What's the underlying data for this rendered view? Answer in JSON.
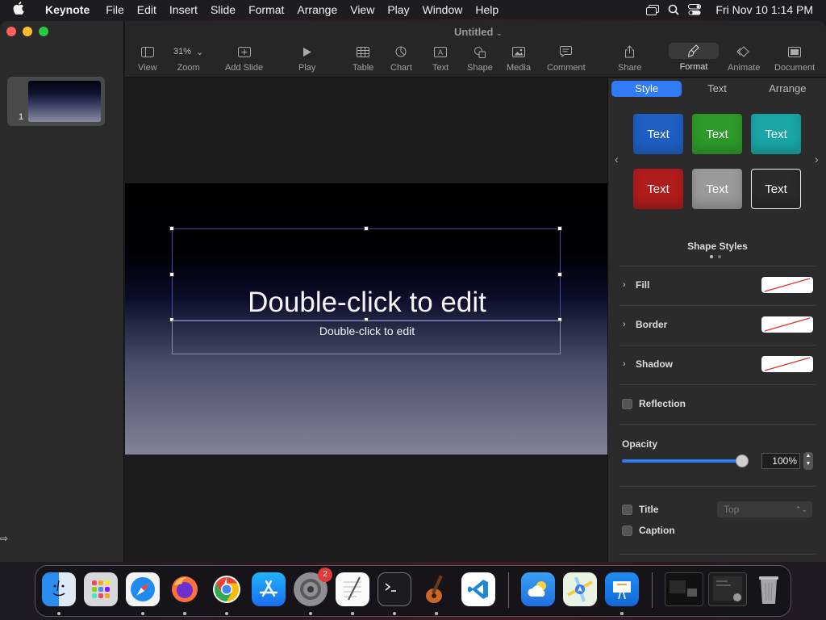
{
  "menubar": {
    "app_name": "Keynote",
    "items": [
      "File",
      "Edit",
      "Insert",
      "Slide",
      "Format",
      "Arrange",
      "View",
      "Play",
      "Window",
      "Help"
    ],
    "clock": "Fri Nov 10  1:14 PM"
  },
  "window": {
    "title": "Untitled"
  },
  "sidebar": {
    "slides": [
      {
        "number": "1"
      }
    ]
  },
  "toolbar": {
    "view": "View",
    "zoom_value": "31%",
    "zoom": "Zoom",
    "add_slide": "Add Slide",
    "play": "Play",
    "table": "Table",
    "chart": "Chart",
    "text": "Text",
    "shape": "Shape",
    "media": "Media",
    "comment": "Comment",
    "share": "Share",
    "format": "Format",
    "animate": "Animate",
    "document": "Document"
  },
  "slide": {
    "title_placeholder": "Double-click to edit",
    "subtitle_placeholder": "Double-click to edit"
  },
  "inspector": {
    "tabs": [
      "Style",
      "Text",
      "Arrange"
    ],
    "style_tiles": [
      {
        "label": "Text",
        "color": "#1f5fc4"
      },
      {
        "label": "Text",
        "color": "#2e9a2a"
      },
      {
        "label": "Text",
        "color": "#1aa6a6"
      },
      {
        "label": "Text",
        "color": "#b01c1c"
      },
      {
        "label": "Text",
        "color": "#9a9a9a"
      },
      {
        "label": "Text",
        "color": "#2b2b2b"
      }
    ],
    "shape_styles_label": "Shape Styles",
    "fill": "Fill",
    "border": "Border",
    "shadow": "Shadow",
    "reflection": "Reflection",
    "opacity_label": "Opacity",
    "opacity_value": "100%",
    "title_label": "Title",
    "title_position": "Top",
    "caption_label": "Caption"
  },
  "dock": {
    "settings_badge": "2",
    "apps": [
      "finder-icon",
      "launchpad-icon",
      "safari-icon",
      "firefox-icon",
      "chrome-icon",
      "app-store-icon",
      "system-settings-icon",
      "textedit-icon",
      "terminal-icon",
      "garageband-icon",
      "vscode-icon",
      "weather-icon",
      "maps-icon",
      "keynote-icon",
      "window-preview",
      "window-preview",
      "trash-icon"
    ]
  },
  "colors": {
    "accent": "#2f7cf6",
    "selection": "#4b4b9a"
  }
}
